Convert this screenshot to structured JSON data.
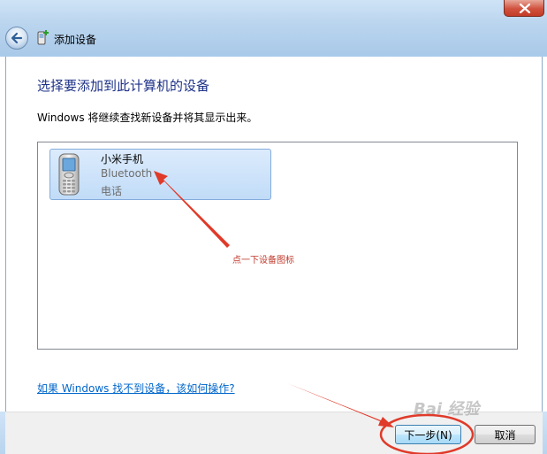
{
  "window": {
    "title": "添加设备",
    "heading": "选择要添加到此计算机的设备",
    "description": "Windows 将继续查找新设备并将其显示出来。"
  },
  "devices": [
    {
      "name": "小米手机",
      "connection": "Bluetooth",
      "category": "电话"
    }
  ],
  "annotation": {
    "text": "点一下设备图标"
  },
  "help_link": "如果 Windows 找不到设备，该如何操作?",
  "buttons": {
    "next": "下一步(N)",
    "cancel": "取消"
  },
  "watermark": "Bai 经验",
  "colors": {
    "annotation_red": "#e03a2a",
    "heading_blue": "#1e3287",
    "link_blue": "#0066cc"
  }
}
